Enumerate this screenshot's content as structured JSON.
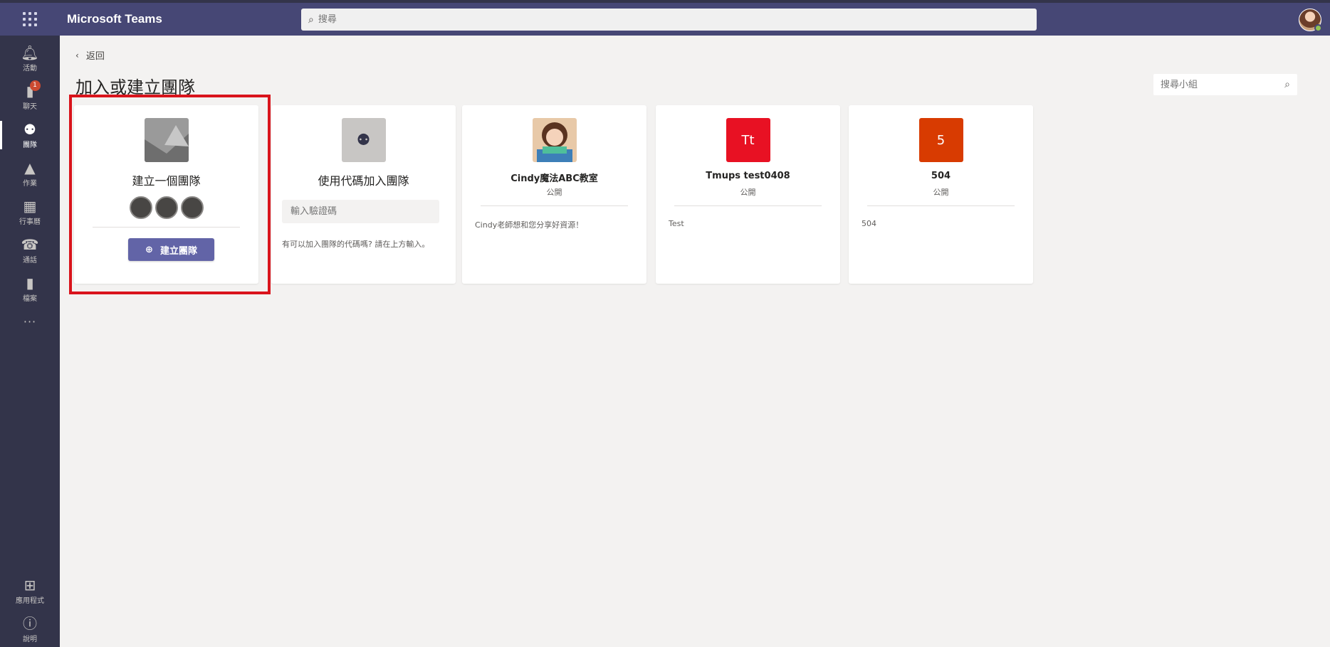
{
  "app": {
    "title": "Microsoft Teams"
  },
  "search": {
    "placeholder": "搜尋"
  },
  "rail": {
    "items": [
      {
        "label": "活動",
        "icon": "bell-icon"
      },
      {
        "label": "聊天",
        "icon": "chat-icon",
        "badge": "1"
      },
      {
        "label": "團隊",
        "icon": "teams-icon",
        "active": true
      },
      {
        "label": "作業",
        "icon": "assignments-icon"
      },
      {
        "label": "行事曆",
        "icon": "calendar-icon"
      },
      {
        "label": "通話",
        "icon": "phone-icon"
      },
      {
        "label": "檔案",
        "icon": "file-icon"
      }
    ],
    "more": "···",
    "bottom": [
      {
        "label": "應用程式",
        "icon": "apps-icon"
      },
      {
        "label": "說明",
        "icon": "help-icon"
      }
    ]
  },
  "main": {
    "back_label": "返回",
    "title": "加入或建立團隊",
    "group_search_placeholder": "搜尋小組"
  },
  "cards": {
    "create": {
      "title": "建立一個團隊",
      "button": "建立團隊"
    },
    "join": {
      "title": "使用代碼加入團隊",
      "input_placeholder": "輸入驗證碼",
      "hint": "有可以加入團隊的代碼嗎? 請在上方輸入。"
    },
    "teams": [
      {
        "name": "Cindy魔法ABC教室",
        "privacy": "公開",
        "desc": "Cindy老師想和您分享好資源！",
        "avatar_type": "photo"
      },
      {
        "name": "Tmups test0408",
        "privacy": "公開",
        "desc": "Test",
        "initials": "Tt",
        "color": "#e81123"
      },
      {
        "name": "504",
        "privacy": "公開",
        "desc": "504",
        "initials": "5",
        "color": "#d83b01"
      }
    ]
  },
  "colors": {
    "brand": "#464775",
    "rail": "#33344a",
    "accent": "#6264a7",
    "highlight": "#d9141c"
  }
}
